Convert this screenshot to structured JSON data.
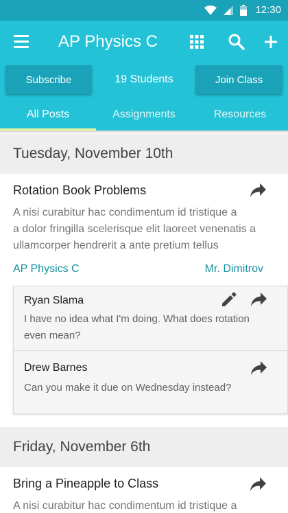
{
  "status_bar": {
    "time": "12:30"
  },
  "app_bar": {
    "title": "AP Physics C",
    "subscribe_label": "Subscribe",
    "students_label": "19 Students",
    "join_label": "Join Class",
    "tabs": [
      {
        "label": "All Posts",
        "active": true
      },
      {
        "label": "Assignments",
        "active": false
      },
      {
        "label": "Resources",
        "active": false
      }
    ]
  },
  "sections": [
    {
      "date": "Tuesday, November 10th",
      "post": {
        "title": "Rotation Book Problems",
        "body_lines": [
          "A nisi curabitur hac condimentum id tristique a",
          "a dolor fringilla scelerisque elit laoreet venenatis a",
          "ullamcorper hendrerit a ante pretium tellus"
        ],
        "class_link": "AP Physics C",
        "teacher_link": "Mr. Dimitrov",
        "comments": [
          {
            "author": "Ryan Slama",
            "text_lines": [
              "I have no idea what I'm doing. What does rotation",
              "even mean?"
            ]
          },
          {
            "author": "Drew Barnes",
            "text_lines": [
              "Can you make it due on Wednesday instead?"
            ]
          }
        ]
      }
    },
    {
      "date": "Friday, November 6th",
      "post": {
        "title": "Bring a Pineapple to Class",
        "body_lines": [
          "A nisi curabitur hac condimentum id tristique a"
        ]
      }
    }
  ],
  "colors": {
    "primary": "#24c2d6",
    "primary_dark": "#1aa3b8",
    "tab_indicator": "#e2f59a",
    "link": "#16919e"
  },
  "icons": [
    "menu-icon",
    "apps-grid-icon",
    "search-icon",
    "add-icon",
    "share-icon",
    "edit-icon",
    "wifi-icon",
    "signal-icon",
    "battery-icon"
  ]
}
